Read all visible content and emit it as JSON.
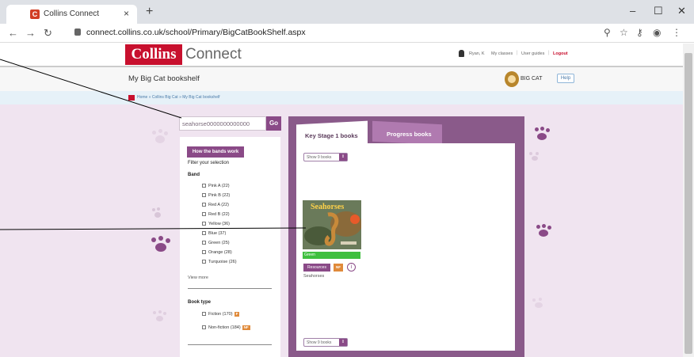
{
  "browser": {
    "tab_title": "Collins Connect",
    "favicon_letter": "C",
    "tab_close": "×",
    "new_tab": "+",
    "url": "connect.collins.co.uk/school/Primary/BigCatBookShelf.aspx",
    "window_controls": [
      "–",
      "☐",
      "✕"
    ]
  },
  "header": {
    "logo_primary": "Collins",
    "logo_secondary": "Connect",
    "user_name": "Ryan, K",
    "my_classes": "My classes",
    "user_guides": "User guides",
    "logout": "Logout"
  },
  "subheader": {
    "title": "My Big Cat bookshelf",
    "brand": "BIG CAT",
    "help": "Help"
  },
  "breadcrumb": [
    "Home",
    "Collins Big Cat",
    "My Big Cat bookshelf"
  ],
  "breadcrumb_text": "Home » Collins Big Cat » My Big Cat bookshelf",
  "search": {
    "value": "seahorse0000000000000",
    "go": "Go"
  },
  "filters": {
    "bands_button": "How the bands work",
    "filter_heading": "Filter your selection",
    "band_heading": "Band",
    "bands": [
      {
        "label": "Pink A (22)"
      },
      {
        "label": "Pink B (22)"
      },
      {
        "label": "Red A (22)"
      },
      {
        "label": "Red B (22)"
      },
      {
        "label": "Yellow (36)"
      },
      {
        "label": "Blue (37)"
      },
      {
        "label": "Green (25)"
      },
      {
        "label": "Orange (28)"
      },
      {
        "label": "Turquoise (26)"
      }
    ],
    "view_more": "View more",
    "book_type_heading": "Book type",
    "book_types": [
      {
        "label": "Fiction (170)",
        "tag": "F"
      },
      {
        "label": "Non-fiction (184)",
        "tag": "NF"
      }
    ]
  },
  "shelf": {
    "tabs": [
      "Key Stage 1 books",
      "Progress books"
    ],
    "show_select": "Show 9 books",
    "book": {
      "cover_title": "Seahorses",
      "band": "Green",
      "resources": "Resources",
      "type_tag": "NF",
      "info": "i",
      "name": "Seahorses"
    }
  },
  "colors": {
    "brand_red": "#c8102e",
    "purple": "#8a4a87",
    "band_green": "#3fbf3f",
    "page_bg": "#f0e4f0"
  }
}
